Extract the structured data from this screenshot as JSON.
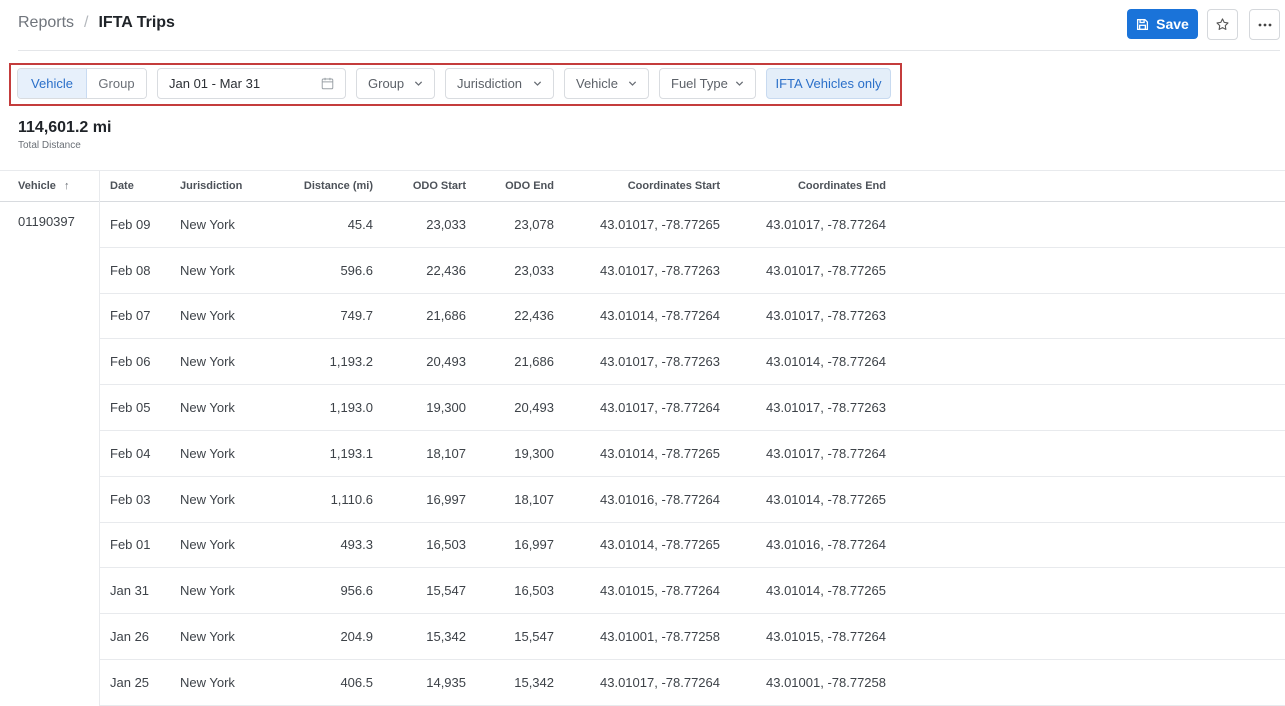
{
  "breadcrumb": {
    "parent": "Reports",
    "separator": "/",
    "current": "IFTA Trips"
  },
  "actions": {
    "save_label": "Save"
  },
  "filters": {
    "segment": [
      "Vehicle",
      "Group"
    ],
    "date_range": "Jan 01 - Mar 31",
    "group": "Group",
    "jurisdiction": "Jurisdiction",
    "vehicle": "Vehicle",
    "fuel_type": "Fuel Type",
    "ifta_toggle": "IFTA Vehicles only"
  },
  "summary": {
    "value": "114,601.2 mi",
    "label": "Total Distance"
  },
  "table": {
    "headers": {
      "vehicle": "Vehicle",
      "sort_arrow": "↑",
      "date": "Date",
      "jurisdiction": "Jurisdiction",
      "distance": "Distance (mi)",
      "odo_start": "ODO Start",
      "odo_end": "ODO End",
      "coords_start": "Coordinates Start",
      "coords_end": "Coordinates End"
    },
    "vehicle_id": "01190397",
    "rows": [
      {
        "date": "Feb 09",
        "jurisdiction": "New York",
        "distance": "45.4",
        "odo_start": "23,033",
        "odo_end": "23,078",
        "coords_start": "43.01017, -78.77265",
        "coords_end": "43.01017, -78.77264"
      },
      {
        "date": "Feb 08",
        "jurisdiction": "New York",
        "distance": "596.6",
        "odo_start": "22,436",
        "odo_end": "23,033",
        "coords_start": "43.01017, -78.77263",
        "coords_end": "43.01017, -78.77265"
      },
      {
        "date": "Feb 07",
        "jurisdiction": "New York",
        "distance": "749.7",
        "odo_start": "21,686",
        "odo_end": "22,436",
        "coords_start": "43.01014, -78.77264",
        "coords_end": "43.01017, -78.77263"
      },
      {
        "date": "Feb 06",
        "jurisdiction": "New York",
        "distance": "1,193.2",
        "odo_start": "20,493",
        "odo_end": "21,686",
        "coords_start": "43.01017, -78.77263",
        "coords_end": "43.01014, -78.77264"
      },
      {
        "date": "Feb 05",
        "jurisdiction": "New York",
        "distance": "1,193.0",
        "odo_start": "19,300",
        "odo_end": "20,493",
        "coords_start": "43.01017, -78.77264",
        "coords_end": "43.01017, -78.77263"
      },
      {
        "date": "Feb 04",
        "jurisdiction": "New York",
        "distance": "1,193.1",
        "odo_start": "18,107",
        "odo_end": "19,300",
        "coords_start": "43.01014, -78.77265",
        "coords_end": "43.01017, -78.77264"
      },
      {
        "date": "Feb 03",
        "jurisdiction": "New York",
        "distance": "1,110.6",
        "odo_start": "16,997",
        "odo_end": "18,107",
        "coords_start": "43.01016, -78.77264",
        "coords_end": "43.01014, -78.77265"
      },
      {
        "date": "Feb 01",
        "jurisdiction": "New York",
        "distance": "493.3",
        "odo_start": "16,503",
        "odo_end": "16,997",
        "coords_start": "43.01014, -78.77265",
        "coords_end": "43.01016, -78.77264"
      },
      {
        "date": "Jan 31",
        "jurisdiction": "New York",
        "distance": "956.6",
        "odo_start": "15,547",
        "odo_end": "16,503",
        "coords_start": "43.01015, -78.77264",
        "coords_end": "43.01014, -78.77265"
      },
      {
        "date": "Jan 26",
        "jurisdiction": "New York",
        "distance": "204.9",
        "odo_start": "15,342",
        "odo_end": "15,547",
        "coords_start": "43.01001, -78.77258",
        "coords_end": "43.01015, -78.77264"
      },
      {
        "date": "Jan 25",
        "jurisdiction": "New York",
        "distance": "406.5",
        "odo_start": "14,935",
        "odo_end": "15,342",
        "coords_start": "43.01017, -78.77264",
        "coords_end": "43.01001, -78.77258"
      }
    ]
  },
  "colors": {
    "accent": "#1a73d9",
    "highlight_border": "#c43c3c",
    "active_filter_bg": "#e4eef9"
  },
  "icons": {
    "save": "floppy-disk-icon",
    "favorite": "star-icon",
    "more": "more-horizontal-icon",
    "calendar": "calendar-icon",
    "dropdown": "chevron-down-icon",
    "sort": "sort-ascending-icon"
  }
}
